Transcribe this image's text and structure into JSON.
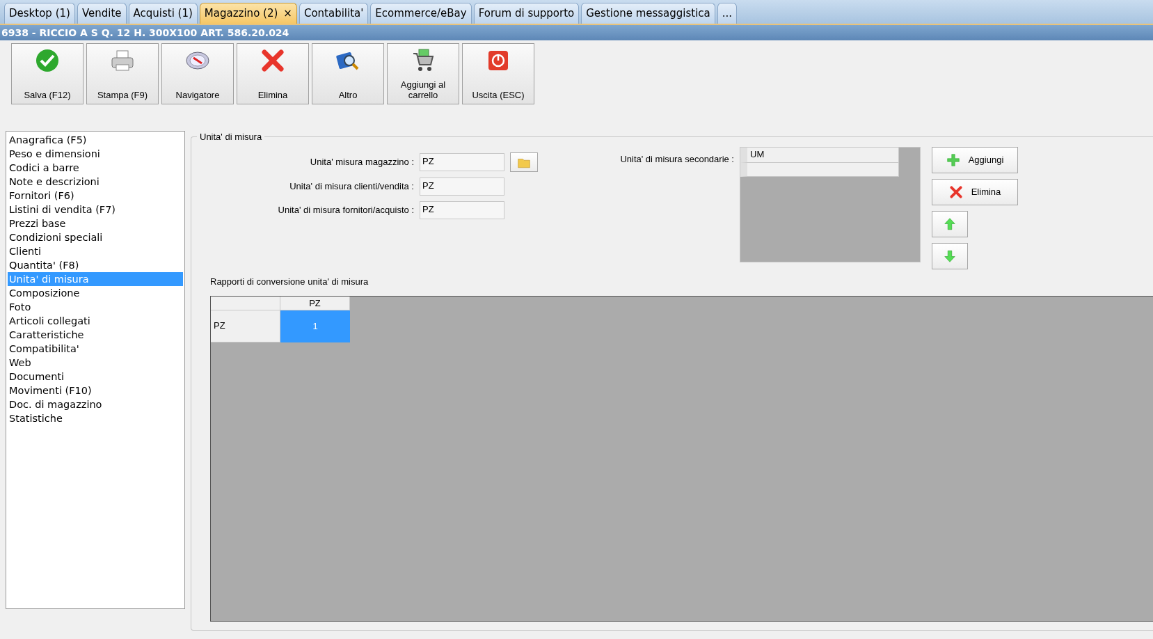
{
  "tabs": [
    {
      "label": "Desktop (1)",
      "selected": false,
      "closable": false
    },
    {
      "label": "Vendite",
      "selected": false,
      "closable": false
    },
    {
      "label": "Acquisti (1)",
      "selected": false,
      "closable": false
    },
    {
      "label": "Magazzino (2)",
      "selected": true,
      "closable": true,
      "close_label": "×"
    },
    {
      "label": "Contabilita'",
      "selected": false,
      "closable": false
    },
    {
      "label": "Ecommerce/eBay",
      "selected": false,
      "closable": false
    },
    {
      "label": "Forum di supporto",
      "selected": false,
      "closable": false
    },
    {
      "label": "Gestione messaggistica",
      "selected": false,
      "closable": false
    },
    {
      "label": "...",
      "selected": false,
      "closable": false
    }
  ],
  "title": "6938 - RICCIO A S Q. 12 H. 300X100 ART. 586.20.024",
  "toolbar": [
    {
      "label": "Salva (F12)",
      "kind": "save"
    },
    {
      "label": "Stampa (F9)",
      "kind": "print"
    },
    {
      "label": "Navigatore",
      "kind": "compass"
    },
    {
      "label": "Elimina",
      "kind": "delete"
    },
    {
      "label": "Altro",
      "kind": "search"
    },
    {
      "label": "Aggiungi al carrello",
      "kind": "cart"
    },
    {
      "label": "Uscita (ESC)",
      "kind": "exit"
    }
  ],
  "sidebar": {
    "items": [
      {
        "label": "Anagrafica (F5)",
        "selected": false
      },
      {
        "label": "Peso e dimensioni",
        "selected": false
      },
      {
        "label": "Codici a barre",
        "selected": false
      },
      {
        "label": "Note e descrizioni",
        "selected": false
      },
      {
        "label": "Fornitori (F6)",
        "selected": false
      },
      {
        "label": "Listini di vendita (F7)",
        "selected": false
      },
      {
        "label": "Prezzi base",
        "selected": false
      },
      {
        "label": "Condizioni speciali",
        "selected": false
      },
      {
        "label": "Clienti",
        "selected": false
      },
      {
        "label": "Quantita' (F8)",
        "selected": false
      },
      {
        "label": "Unita' di misura",
        "selected": true
      },
      {
        "label": "Composizione",
        "selected": false
      },
      {
        "label": "Foto",
        "selected": false
      },
      {
        "label": "Articoli collegati",
        "selected": false
      },
      {
        "label": "Caratteristiche",
        "selected": false
      },
      {
        "label": "Compatibilita'",
        "selected": false
      },
      {
        "label": "Web",
        "selected": false
      },
      {
        "label": "Documenti",
        "selected": false
      },
      {
        "label": "Movimenti (F10)",
        "selected": false
      },
      {
        "label": "Doc. di magazzino",
        "selected": false
      },
      {
        "label": "Statistiche",
        "selected": false
      }
    ]
  },
  "group": {
    "title": "Unita' di misura",
    "fields": [
      {
        "label": "Unita' misura magazzino :",
        "value": "PZ",
        "kind": "lookup"
      },
      {
        "label": "Unita' di misura clienti/vendita :",
        "value": "PZ",
        "kind": "plain"
      },
      {
        "label": "Unita' di misura fornitori/acquisto :",
        "value": "PZ",
        "kind": "plain"
      }
    ],
    "secondary": {
      "label": "Unita' di misura secondarie :",
      "column": "UM"
    },
    "buttons": [
      {
        "label": "Aggiungi",
        "kind": "add"
      },
      {
        "label": "Elimina",
        "kind": "delete"
      },
      {
        "kind": "up"
      },
      {
        "kind": "down"
      }
    ],
    "conversion": {
      "label": "Rapporti di conversione unita' di misura",
      "columns": [
        "PZ"
      ],
      "rows": [
        {
          "label": "PZ",
          "cells": [
            {
              "value": "1",
              "selected": true
            }
          ]
        }
      ]
    }
  }
}
